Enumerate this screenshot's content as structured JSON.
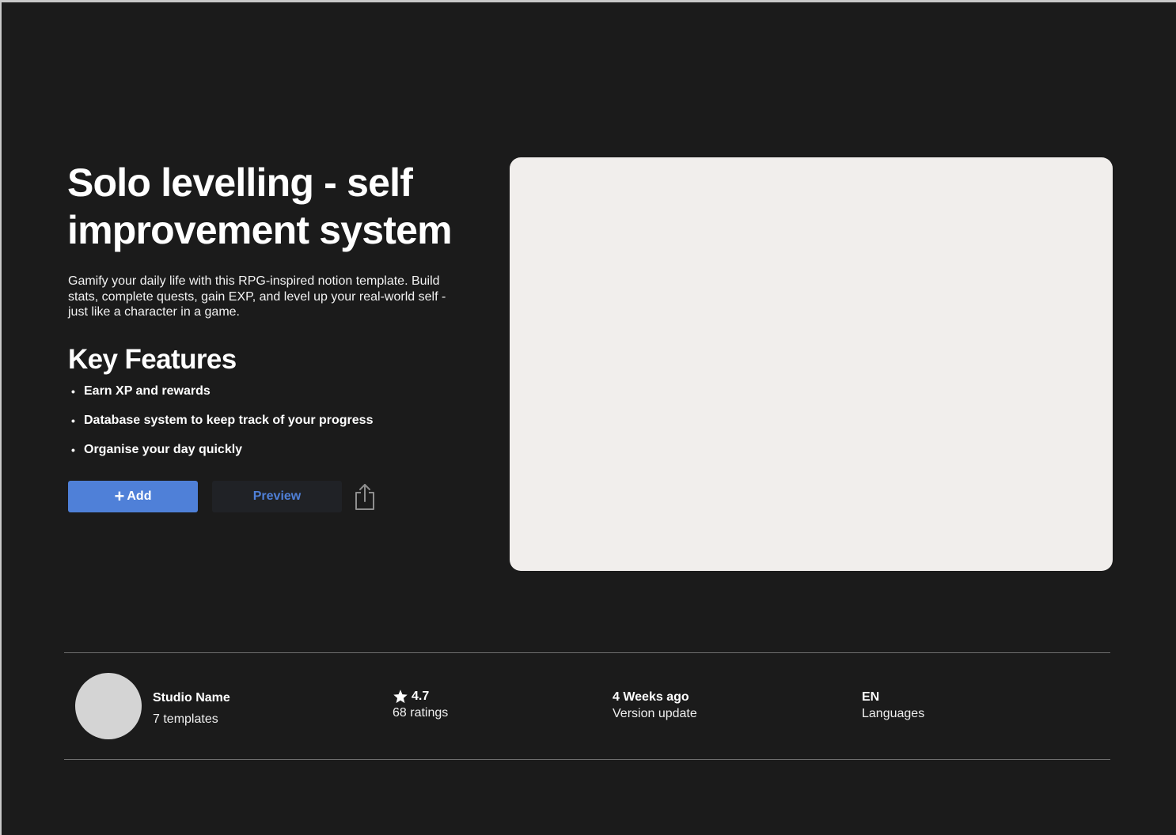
{
  "product": {
    "title": "Solo levelling - self improvement system",
    "description": "Gamify your daily life with this RPG-inspired notion template. Build stats, complete quests, gain EXP, and level up your real-world self - just like a character in a game."
  },
  "features": {
    "heading": "Key Features",
    "items": [
      "Earn XP  and rewards",
      "Database system to keep track of your progress",
      "Organise your day quickly"
    ],
    "bullet": "•"
  },
  "actions": {
    "add_label": "Add",
    "add_icon": "plus-icon",
    "add_plus": "+",
    "preview_label": "Preview",
    "share_icon": "share-icon"
  },
  "creator": {
    "name": "Studio Name",
    "templates": "7 templates"
  },
  "stats": {
    "rating": {
      "value": "4.7",
      "label": "68 ratings",
      "icon": "star-icon"
    },
    "version": {
      "value": "4 Weeks ago",
      "label": "Version update"
    },
    "language": {
      "value": "EN",
      "label": "Languages"
    }
  },
  "colors": {
    "background": "#1b1b1b",
    "accent": "#4f80d8",
    "preview_card": "#f1eeec",
    "secondary_button": "#202226",
    "avatar": "#d4d4d4"
  }
}
